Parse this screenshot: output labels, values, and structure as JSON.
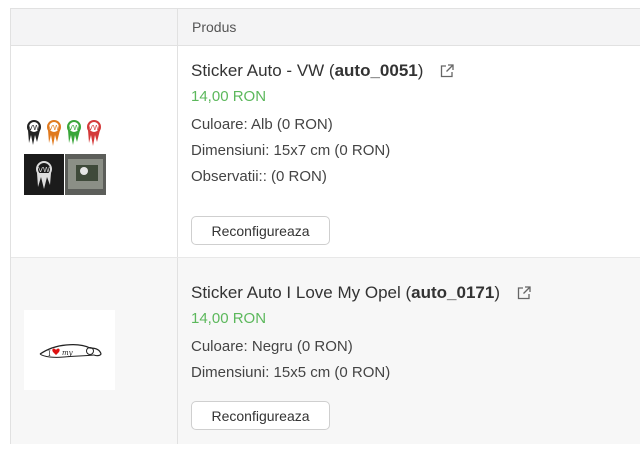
{
  "header": {
    "column_label": "Produs"
  },
  "items": [
    {
      "name": "Sticker Auto - VW (",
      "code": "auto_0051",
      "close": ")",
      "price": "14,00 RON",
      "options": [
        "Culoare: Alb (0 RON)",
        "Dimensiuni: 15x7 cm (0 RON)",
        "Observatii:: (0 RON)"
      ],
      "button_label": "Reconfigureaza"
    },
    {
      "name": "Sticker Auto I Love My Opel (",
      "code": "auto_0171",
      "close": ")",
      "price": "14,00 RON",
      "options": [
        "Culoare: Negru (0 RON)",
        "Dimensiuni: 15x5 cm (0 RON)"
      ],
      "button_label": "Reconfigureaza"
    }
  ],
  "colors": {
    "price": "#5cb85c",
    "border": "#e1e1e1",
    "header_bg": "#f4f4f5",
    "row_alt_bg": "#f7f7f7"
  }
}
